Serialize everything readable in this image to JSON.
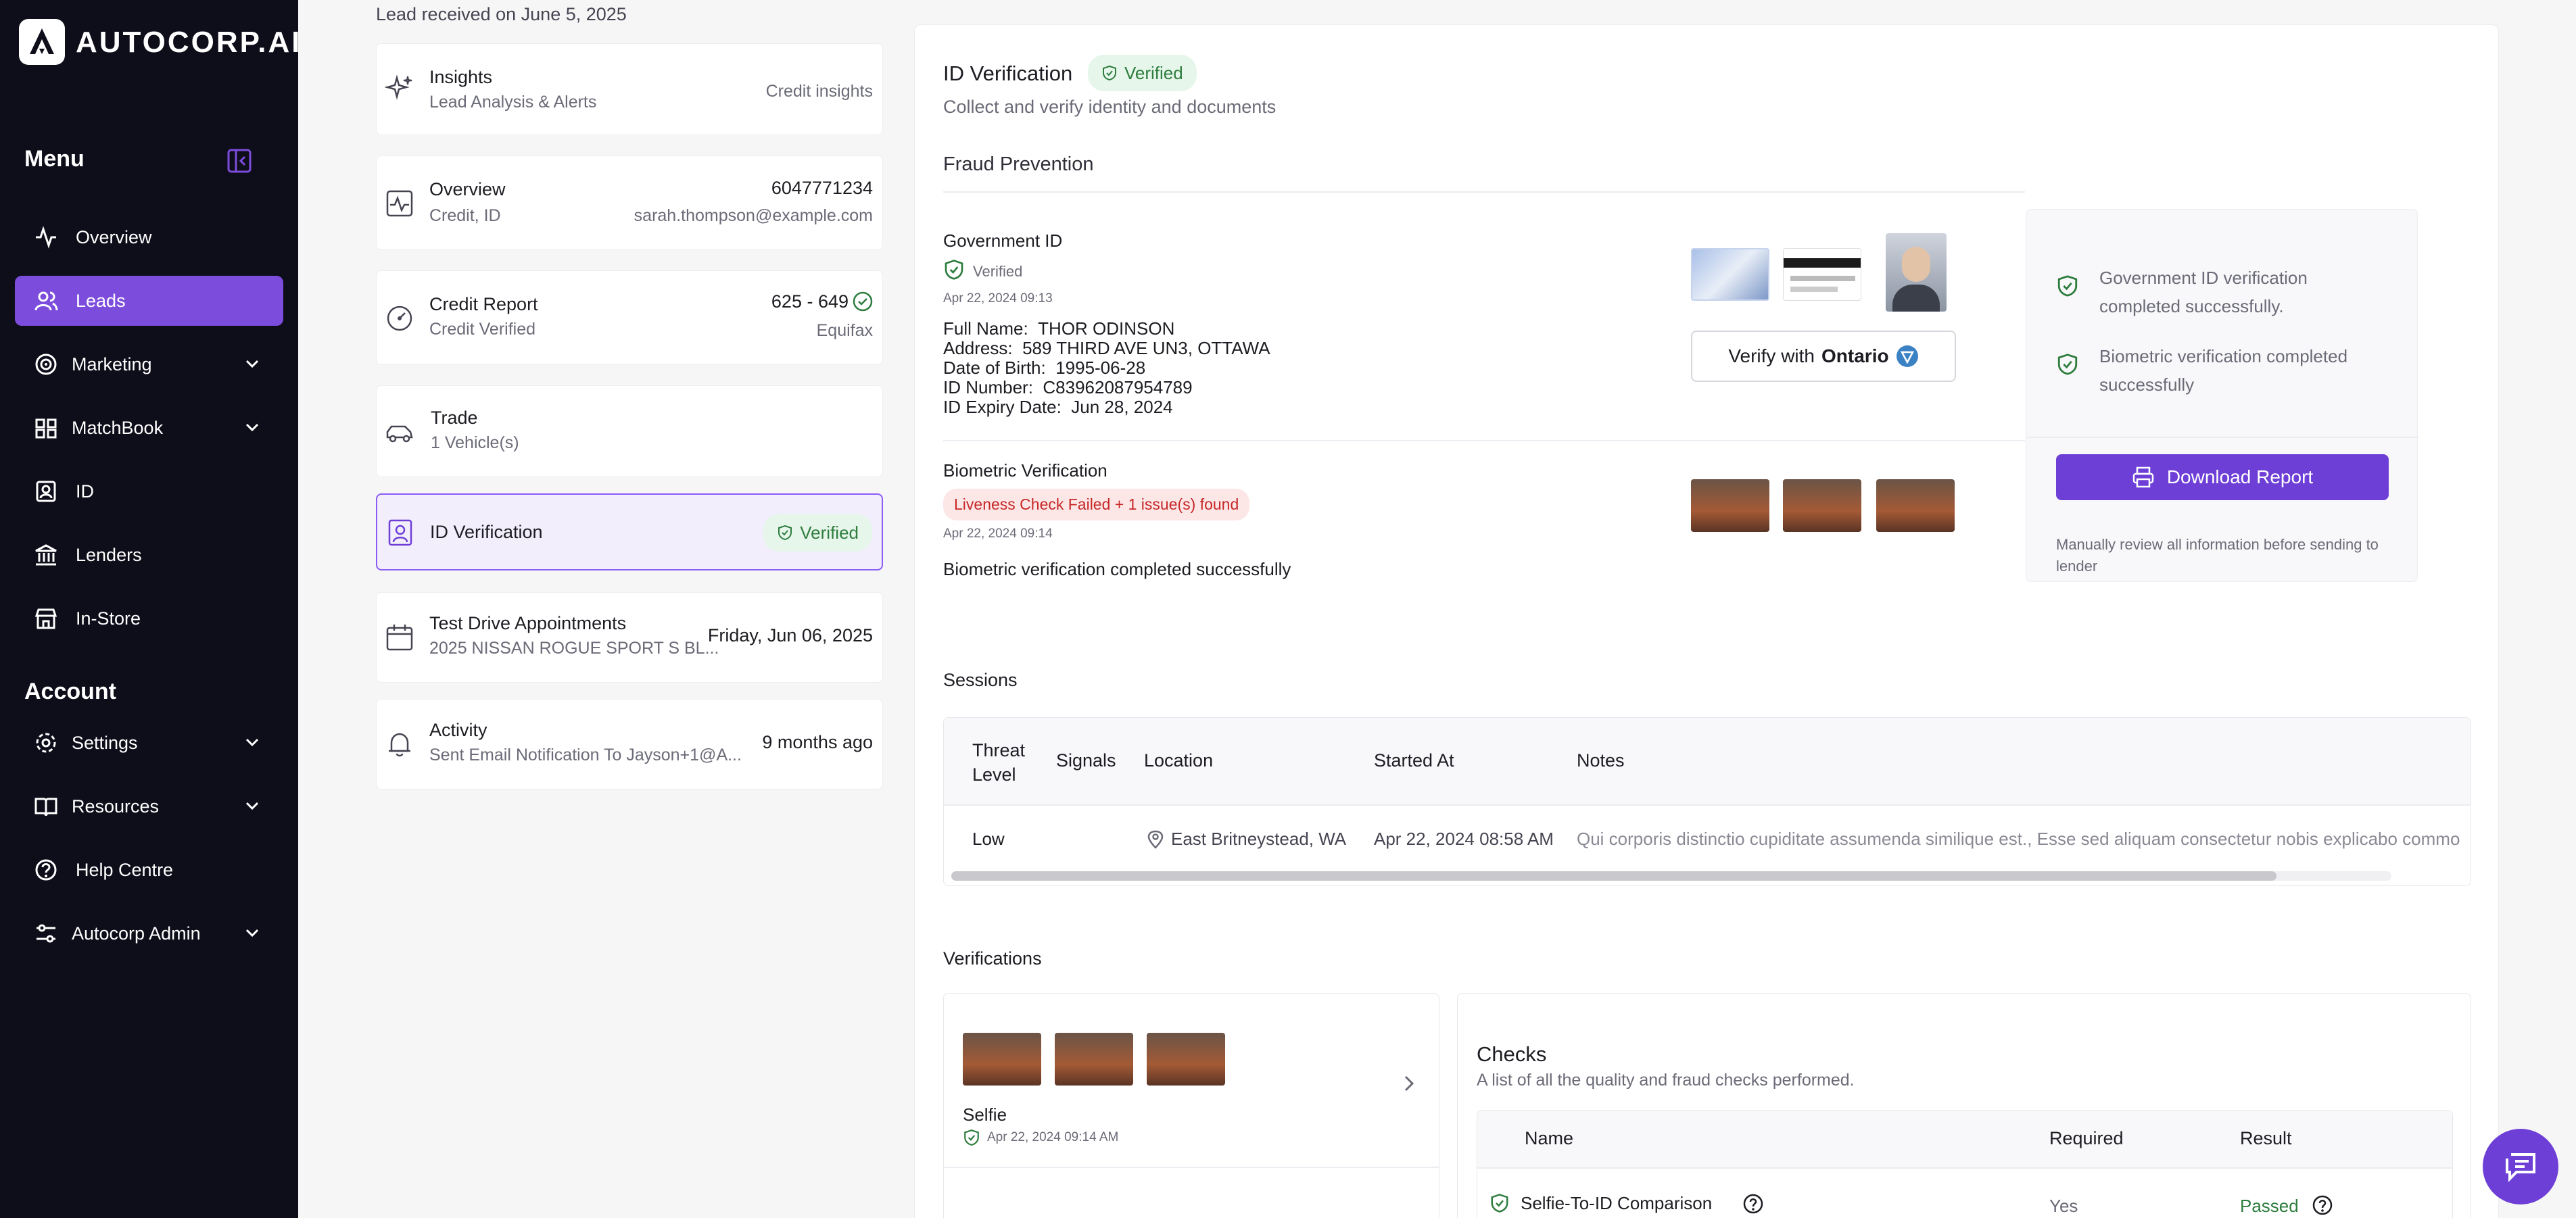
{
  "brand": {
    "name": "AUTOCORP.AI"
  },
  "sidebar": {
    "menu_title": "Menu",
    "account_title": "Account",
    "items": [
      {
        "label": "Overview",
        "icon": "activity-icon"
      },
      {
        "label": "Leads",
        "icon": "users-icon",
        "active": true
      },
      {
        "label": "Marketing",
        "icon": "target-icon"
      },
      {
        "label": "MatchBook",
        "icon": "book-icon"
      },
      {
        "label": "ID",
        "icon": "id-card-icon"
      },
      {
        "label": "Lenders",
        "icon": "bank-icon"
      },
      {
        "label": "In-Store",
        "icon": "store-icon"
      }
    ],
    "account_items": [
      {
        "label": "Settings",
        "icon": "gear-icon"
      },
      {
        "label": "Resources",
        "icon": "book-open-icon"
      },
      {
        "label": "Help Centre",
        "icon": "help-icon"
      },
      {
        "label": "Autocorp Admin",
        "icon": "admin-icon"
      }
    ]
  },
  "lead": {
    "received": "Lead received on June 5, 2025",
    "cards": {
      "insights": {
        "title": "Insights",
        "sub": "Lead Analysis & Alerts",
        "right": "Credit insights"
      },
      "overview": {
        "title": "Overview",
        "sub": "Credit, ID",
        "phone": "6047771234",
        "email": "sarah.thompson@example.com"
      },
      "credit": {
        "title": "Credit Report",
        "sub": "Credit Verified",
        "score": "625 - 649",
        "bureau": "Equifax"
      },
      "trade": {
        "title": "Trade",
        "sub": "1 Vehicle(s)"
      },
      "idv": {
        "title": "ID Verification",
        "status": "Verified"
      },
      "testdrive": {
        "title": "Test Drive Appointments",
        "sub": "2025 NISSAN ROGUE SPORT S BL...",
        "date": "Friday, Jun 06, 2025"
      },
      "activity": {
        "title": "Activity",
        "sub": "Sent Email Notification To Jayson+1@A...",
        "time": "9 months ago"
      }
    }
  },
  "main": {
    "title": "ID Verification",
    "status": "Verified",
    "subtitle": "Collect and verify identity and documents",
    "fraud_title": "Fraud Prevention",
    "gov": {
      "title": "Government ID",
      "status": "Verified",
      "timestamp": "Apr 22, 2024 09:13",
      "fields": [
        {
          "label": "Full Name:",
          "value": "THOR ODINSON"
        },
        {
          "label": "Address:",
          "value": "589 THIRD AVE UN3, OTTAWA"
        },
        {
          "label": "Date of Birth:",
          "value": "1995-06-28"
        },
        {
          "label": "ID Number:",
          "value": "C83962087954789"
        },
        {
          "label": "ID Expiry Date:",
          "value": "Jun 28, 2024"
        }
      ],
      "verify_btn_prefix": "Verify with",
      "verify_btn_brand": "Ontario"
    },
    "bio": {
      "title": "Biometric Verification",
      "alert": "Liveness Check Failed + 1 issue(s) found",
      "timestamp": "Apr 22, 2024 09:14",
      "result": "Biometric verification completed successfully"
    },
    "summary": {
      "items": [
        "Government ID verification completed successfully.",
        "Biometric verification completed successfully"
      ],
      "download_label": "Download Report",
      "note": "Manually review all information before sending to lender"
    },
    "sessions": {
      "title": "Sessions",
      "columns": [
        "Threat Level",
        "Signals",
        "Location",
        "Started At",
        "Notes"
      ],
      "rows": [
        {
          "threat": "Low",
          "signals": "",
          "location": "East Britneystead, WA",
          "started": "Apr 22, 2024 08:58 AM",
          "notes": "Qui corporis distinctio cupiditate assumenda similique est., Esse sed aliquam consectetur nobis explicabo commo"
        }
      ]
    },
    "verifications": {
      "title": "Verifications",
      "selfie_label": "Selfie",
      "selfie_time": "Apr 22, 2024 09:14 AM"
    },
    "checks": {
      "title": "Checks",
      "subtitle": "A list of all the quality and fraud checks performed.",
      "columns": [
        "Name",
        "Required",
        "Result"
      ],
      "rows": [
        {
          "name": "Selfie-To-ID Comparison",
          "required": "Yes",
          "result": "Passed"
        }
      ]
    }
  },
  "colors": {
    "accent": "#6e3fd6",
    "sidebar_bg": "#0e0d1a",
    "success": "#2e7d3e",
    "danger": "#c62828"
  }
}
